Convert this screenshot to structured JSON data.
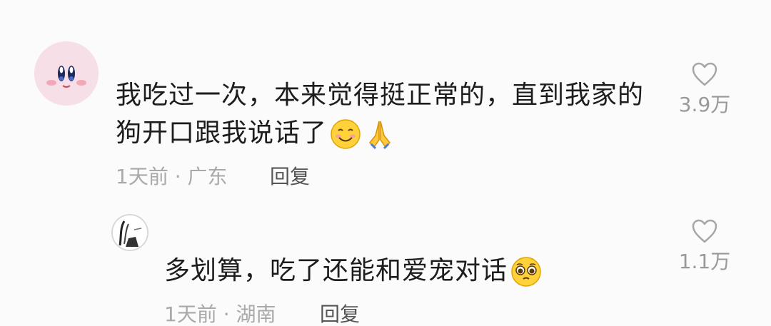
{
  "comment": {
    "text_line1": "我吃过一次，本来觉得挺正常的，直到我家的",
    "text_line2": "狗开口跟我说话了",
    "emojis": [
      "smile-face-icon",
      "pray-hands-icon"
    ],
    "time": "1天前",
    "location": "广东",
    "meta": "1天前 · 广东",
    "reply_label": "回复",
    "like_count": "3.9万"
  },
  "reply": {
    "text": "多划算，吃了还能和爱宠对话",
    "emojis": [
      "pleading-face-icon"
    ],
    "time": "1天前",
    "location": "湖南",
    "meta": "1天前 · 湖南",
    "reply_label": "回复",
    "like_count": "1.1万"
  },
  "colors": {
    "background": "#fbfbfb",
    "text": "#1d1d1d",
    "meta": "#a9a9a9",
    "like": "#999999"
  }
}
